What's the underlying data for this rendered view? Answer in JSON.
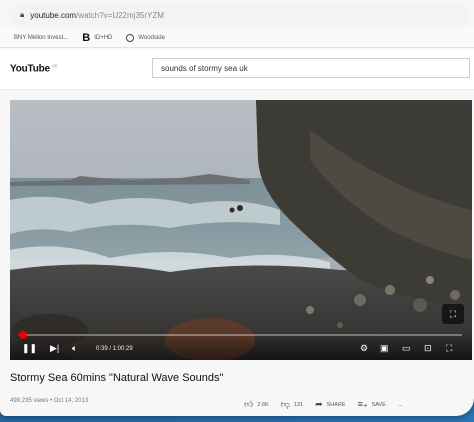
{
  "browser": {
    "url_host": "youtube.com",
    "url_path": "/watch?v=U22mj35rYZM",
    "bookmarks": [
      {
        "label": "BNY Mellon Invest...",
        "icon": "none"
      },
      {
        "label": "ID+HD",
        "icon": "b-logo"
      },
      {
        "label": "Woodside",
        "icon": "globe-icon"
      }
    ]
  },
  "header": {
    "logo": "YouTube",
    "logo_suffix": "GB",
    "search_value": "sounds of stormy sea uk"
  },
  "player": {
    "time_display": "0:39 / 1:00:29",
    "progress_fraction": 0.011,
    "fullscreen_tip": "⛶"
  },
  "video": {
    "title": "Stormy Sea 60mins \"Natural Wave Sounds\"",
    "meta": "499,235 views • Oct 14, 2013",
    "likes": "2.6K",
    "dislikes": "131",
    "share_label": "SHARE",
    "save_label": "SAVE",
    "more_label": "..."
  },
  "colors": {
    "accent": "#e00000",
    "desk_blue": "#2a73b5"
  }
}
